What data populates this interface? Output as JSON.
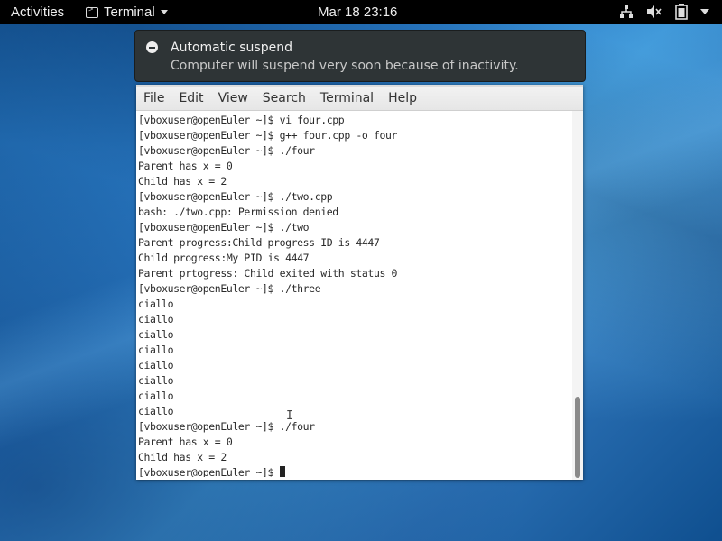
{
  "topbar": {
    "activities": "Activities",
    "app_name": "Terminal",
    "clock": "Mar 18  23:16",
    "icons": [
      "network-icon",
      "volume-muted-icon",
      "battery-icon",
      "system-menu-caret-icon"
    ]
  },
  "notification": {
    "title": "Automatic suspend",
    "body": "Computer will suspend very soon because of inactivity.",
    "icon": "minus-circle-icon"
  },
  "terminal": {
    "menu": [
      "File",
      "Edit",
      "View",
      "Search",
      "Terminal",
      "Help"
    ],
    "lines": [
      "[vboxuser@openEuler ~]$ vi four.cpp",
      "[vboxuser@openEuler ~]$ g++ four.cpp -o four",
      "[vboxuser@openEuler ~]$ ./four",
      "Parent has x = 0",
      "Child has x = 2",
      "[vboxuser@openEuler ~]$ ./two.cpp",
      "bash: ./two.cpp: Permission denied",
      "[vboxuser@openEuler ~]$ ./two",
      "Parent progress:Child progress ID is 4447",
      "Child progress:My PID is 4447",
      "Parent prtogress: Child exited with status 0",
      "[vboxuser@openEuler ~]$ ./three",
      "ciallo",
      "ciallo",
      "ciallo",
      "ciallo",
      "ciallo",
      "ciallo",
      "ciallo",
      "ciallo",
      "[vboxuser@openEuler ~]$ ./four",
      "Parent has x = 0",
      "Child has x = 2"
    ],
    "prompt": "[vboxuser@openEuler ~]$ "
  },
  "colors": {
    "topbar_bg": "#000000",
    "notification_bg": "#2e3436",
    "terminal_bg": "#ffffff",
    "terminal_text": "#2a2a2a"
  }
}
